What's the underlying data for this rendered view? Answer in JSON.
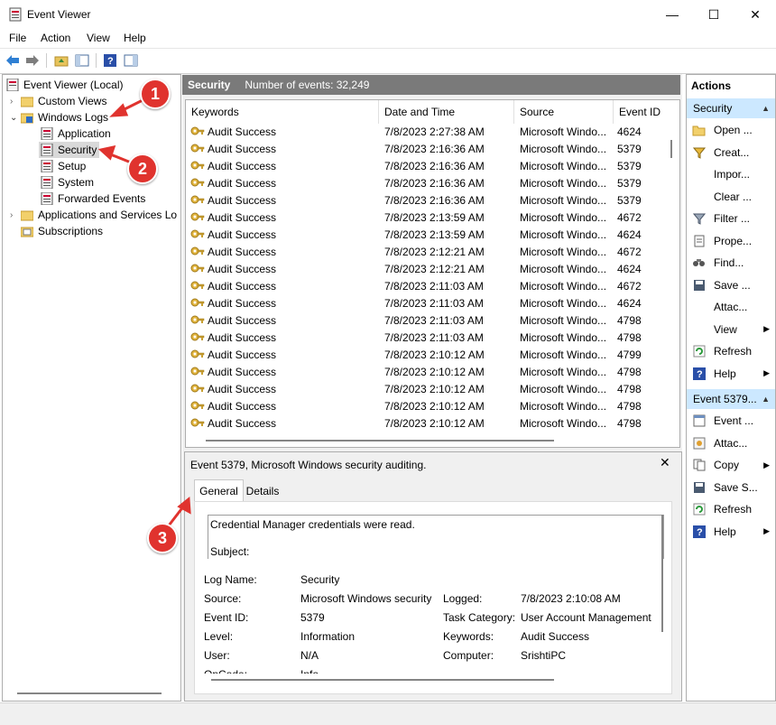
{
  "window": {
    "title": "Event Viewer",
    "minimize": "—",
    "maximize": "☐",
    "close": "✕"
  },
  "menu": {
    "file": "File",
    "action": "Action",
    "view": "View",
    "help": "Help"
  },
  "tree": {
    "root": "Event Viewer (Local)",
    "custom_views": "Custom Views",
    "windows_logs": "Windows Logs",
    "application": "Application",
    "security": "Security",
    "setup": "Setup",
    "system": "System",
    "forwarded_events": "Forwarded Events",
    "app_services": "Applications and Services Lo",
    "subscriptions": "Subscriptions"
  },
  "log_header": {
    "name": "Security",
    "count": "Number of events: 32,249"
  },
  "columns": {
    "keywords": "Keywords",
    "date_time": "Date and Time",
    "source": "Source",
    "event_id": "Event ID"
  },
  "events": [
    {
      "keyword": "Audit Success",
      "date": "7/8/2023 2:27:38 AM",
      "source": "Microsoft Windo...",
      "id": "4624"
    },
    {
      "keyword": "Audit Success",
      "date": "7/8/2023 2:16:36 AM",
      "source": "Microsoft Windo...",
      "id": "5379"
    },
    {
      "keyword": "Audit Success",
      "date": "7/8/2023 2:16:36 AM",
      "source": "Microsoft Windo...",
      "id": "5379"
    },
    {
      "keyword": "Audit Success",
      "date": "7/8/2023 2:16:36 AM",
      "source": "Microsoft Windo...",
      "id": "5379"
    },
    {
      "keyword": "Audit Success",
      "date": "7/8/2023 2:16:36 AM",
      "source": "Microsoft Windo...",
      "id": "5379"
    },
    {
      "keyword": "Audit Success",
      "date": "7/8/2023 2:13:59 AM",
      "source": "Microsoft Windo...",
      "id": "4672"
    },
    {
      "keyword": "Audit Success",
      "date": "7/8/2023 2:13:59 AM",
      "source": "Microsoft Windo...",
      "id": "4624"
    },
    {
      "keyword": "Audit Success",
      "date": "7/8/2023 2:12:21 AM",
      "source": "Microsoft Windo...",
      "id": "4672"
    },
    {
      "keyword": "Audit Success",
      "date": "7/8/2023 2:12:21 AM",
      "source": "Microsoft Windo...",
      "id": "4624"
    },
    {
      "keyword": "Audit Success",
      "date": "7/8/2023 2:11:03 AM",
      "source": "Microsoft Windo...",
      "id": "4672"
    },
    {
      "keyword": "Audit Success",
      "date": "7/8/2023 2:11:03 AM",
      "source": "Microsoft Windo...",
      "id": "4624"
    },
    {
      "keyword": "Audit Success",
      "date": "7/8/2023 2:11:03 AM",
      "source": "Microsoft Windo...",
      "id": "4798"
    },
    {
      "keyword": "Audit Success",
      "date": "7/8/2023 2:11:03 AM",
      "source": "Microsoft Windo...",
      "id": "4798"
    },
    {
      "keyword": "Audit Success",
      "date": "7/8/2023 2:10:12 AM",
      "source": "Microsoft Windo...",
      "id": "4799"
    },
    {
      "keyword": "Audit Success",
      "date": "7/8/2023 2:10:12 AM",
      "source": "Microsoft Windo...",
      "id": "4798"
    },
    {
      "keyword": "Audit Success",
      "date": "7/8/2023 2:10:12 AM",
      "source": "Microsoft Windo...",
      "id": "4798"
    },
    {
      "keyword": "Audit Success",
      "date": "7/8/2023 2:10:12 AM",
      "source": "Microsoft Windo...",
      "id": "4798"
    },
    {
      "keyword": "Audit Success",
      "date": "7/8/2023 2:10:12 AM",
      "source": "Microsoft Windo...",
      "id": "4798"
    }
  ],
  "detail": {
    "title": "Event 5379, Microsoft Windows security auditing.",
    "tab_general": "General",
    "tab_details": "Details",
    "message_line1": "Credential Manager credentials were read.",
    "message_line2": "Subject:",
    "log_name_label": "Log Name:",
    "log_name": "Security",
    "source_label": "Source:",
    "source": "Microsoft Windows security",
    "logged_label": "Logged:",
    "logged": "7/8/2023 2:10:08 AM",
    "event_id_label": "Event ID:",
    "event_id": "5379",
    "task_category_label": "Task Category:",
    "task_category": "User Account Management",
    "level_label": "Level:",
    "level": "Information",
    "keywords_label": "Keywords:",
    "keywords": "Audit Success",
    "user_label": "User:",
    "user": "N/A",
    "computer_label": "Computer:",
    "computer": "SrishtiPC",
    "opcode_label": "OpCode:",
    "opcode": "Info"
  },
  "actions": {
    "header": "Actions",
    "section1": "Security",
    "items1": [
      "Open ...",
      "Creat...",
      "Impor...",
      "Clear ...",
      "Filter ...",
      "Prope...",
      "Find...",
      "Save ...",
      "Attac...",
      "View",
      "Refresh",
      "Help"
    ],
    "section2": "Event 5379...",
    "items2": [
      "Event ...",
      "Attac...",
      "Copy",
      "Save S...",
      "Refresh",
      "Help"
    ]
  },
  "annotations": [
    "1",
    "2",
    "3"
  ],
  "colors": {
    "accent": "#cce8ff",
    "selected": "#d9d9d9",
    "header_bar": "#7a7a7a",
    "badge": "#e0332e"
  }
}
